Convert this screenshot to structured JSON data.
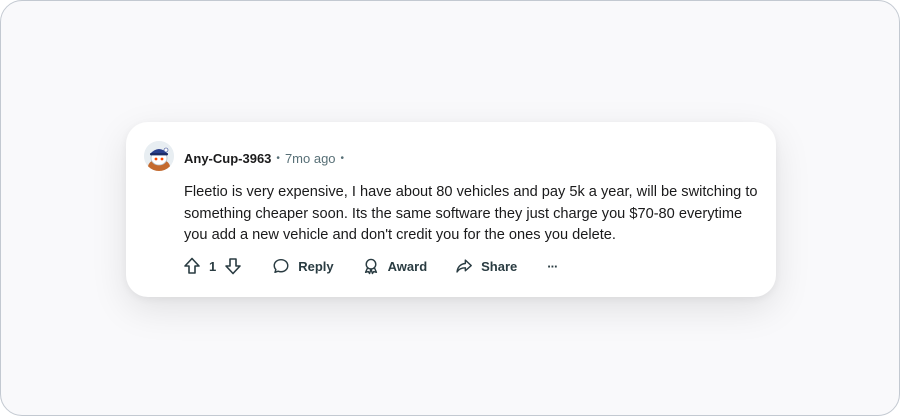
{
  "comment": {
    "username": "Any-Cup-3963",
    "separator": "•",
    "timestamp": "7mo ago",
    "body": "Fleetio is very expensive, I have about 80 vehicles and pay 5k a year, will be switching to something cheaper soon. Its the same software they just charge you $70-80 everytime you add a new vehicle and don't credit you for the ones you delete.",
    "vote_count": "1",
    "reply_label": "Reply",
    "award_label": "Award",
    "share_label": "Share",
    "more_label": "···"
  },
  "icons": {
    "upvote": "arrow-up-icon",
    "downvote": "arrow-down-icon",
    "reply": "speech-bubble-icon",
    "award": "award-ribbon-icon",
    "share": "share-arrow-icon",
    "more": "ellipsis-icon"
  },
  "colors": {
    "text": "#1a1a1b",
    "muted": "#576f76",
    "action": "#2a3c42",
    "card_bg": "#ffffff",
    "page_bg": "#f9f9fb"
  }
}
